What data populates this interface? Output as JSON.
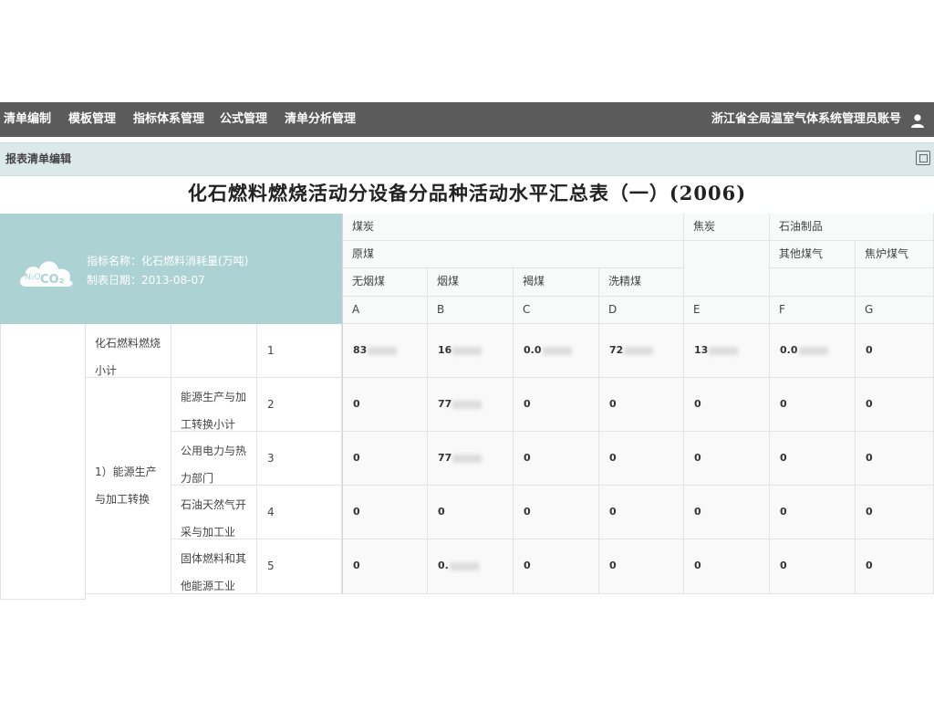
{
  "nav": {
    "items": [
      "清单编制",
      "模板管理",
      "指标体系管理",
      "公式管理",
      "清单分析管理"
    ],
    "user": "浙江省全局温室气体系统管理员账号"
  },
  "panel": {
    "title": "报表清单编辑"
  },
  "report": {
    "title": "化石燃料燃烧活动分设备分品种活动水平汇总表（一）(2006)",
    "indicator": "指标名称：化石燃料消耗量(万吨)",
    "date": "制表日期：2013-08-07",
    "logo_text": "N₂O CO₂"
  },
  "headers": {
    "coal": "煤炭",
    "raw_coal": "原煤",
    "anthracite": "无烟煤",
    "bituminous": "烟煤",
    "lignite": "褐煤",
    "washed_coal": "洗精煤",
    "coke": "焦炭",
    "petroleum": "石油制品",
    "other_gas": "其他煤气",
    "coke_oven_gas": "焦炉煤气",
    "letters": [
      "A",
      "B",
      "C",
      "D",
      "E",
      "F",
      "G"
    ]
  },
  "rows": [
    {
      "l1": "化石燃料燃烧小计",
      "num": "1",
      "values": [
        "83",
        "16",
        "0.0",
        "72",
        "13",
        "0.0",
        "0"
      ],
      "blurred": [
        true,
        true,
        true,
        true,
        true,
        true,
        false
      ]
    },
    {
      "l2": "能源生产与加工转换小计",
      "num": "2",
      "values": [
        "0",
        "77",
        "0",
        "0",
        "0",
        "0",
        "0"
      ],
      "blurred": [
        false,
        true,
        false,
        false,
        false,
        false,
        false
      ]
    },
    {
      "l2": "公用电力与热力部门",
      "num": "3",
      "values": [
        "0",
        "77",
        "0",
        "0",
        "0",
        "0",
        "0"
      ],
      "blurred": [
        false,
        true,
        false,
        false,
        false,
        false,
        false
      ]
    },
    {
      "l2": "石油天然气开采与加工业",
      "num": "4",
      "values": [
        "0",
        "0",
        "0",
        "0",
        "0",
        "0",
        "0"
      ],
      "blurred": [
        false,
        false,
        false,
        false,
        false,
        false,
        false
      ]
    },
    {
      "l2": "固体燃料和其他能源工业",
      "num": "5",
      "values": [
        "0",
        "0.",
        "0",
        "0",
        "0",
        "0",
        "0"
      ],
      "blurred": [
        false,
        true,
        false,
        false,
        false,
        false,
        false
      ]
    }
  ],
  "group_label": "1）能源生产与加工转换",
  "colors": {
    "nav_bg": "#5b5b5b",
    "panel_bg": "#dce9ea",
    "info_bg": "#add2d4"
  }
}
